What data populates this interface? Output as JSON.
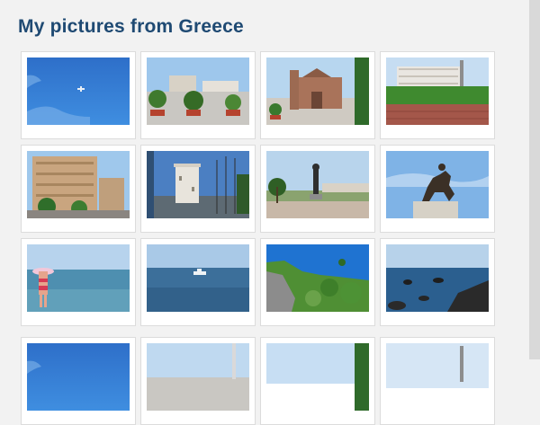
{
  "page": {
    "title": "My pictures from Greece"
  },
  "gallery": {
    "photos": [
      {
        "name": "photo-plane-sky",
        "subject": "airplane in blue sky"
      },
      {
        "name": "photo-park-planters",
        "subject": "park with planters and trees"
      },
      {
        "name": "photo-church-square",
        "subject": "church with square"
      },
      {
        "name": "photo-building-wall",
        "subject": "building behind brick wall"
      },
      {
        "name": "photo-apartment-street",
        "subject": "apartment building street"
      },
      {
        "name": "photo-white-tower",
        "subject": "white tower with flags"
      },
      {
        "name": "photo-statue-square",
        "subject": "statue on square with palms"
      },
      {
        "name": "photo-horse-statue",
        "subject": "equestrian statue"
      },
      {
        "name": "photo-beach-woman",
        "subject": "woman with hat at beach"
      },
      {
        "name": "photo-boat-sea",
        "subject": "boat on sea"
      },
      {
        "name": "photo-coast-cliff",
        "subject": "cliff with plants and sky"
      },
      {
        "name": "photo-rocky-shore",
        "subject": "rocky shore and sea"
      },
      {
        "name": "photo-plane-sky-2",
        "subject": "airplane in blue sky"
      },
      {
        "name": "photo-park-planters-2",
        "subject": "park with planters and trees"
      },
      {
        "name": "photo-church-square-2",
        "subject": "church with square"
      },
      {
        "name": "photo-building-wall-2",
        "subject": "building behind brick wall"
      }
    ]
  },
  "colors": {
    "title": "#1f4a73",
    "background": "#f2f2f2",
    "card": "#ffffff"
  }
}
